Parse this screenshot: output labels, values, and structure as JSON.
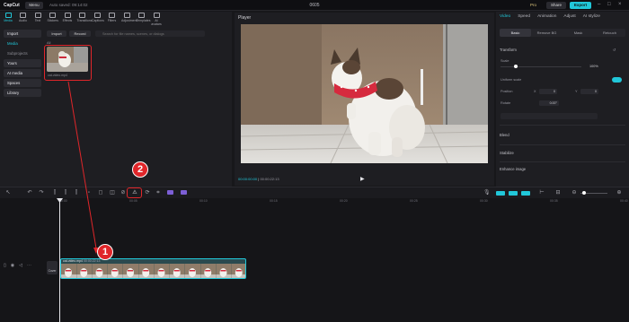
{
  "titlebar": {
    "app_name": "CapCut",
    "menu_label": "Menu",
    "autosave": "Auto saved: 09:14:02",
    "project_title": "0605",
    "pro_label": "Pro",
    "share_label": "Share",
    "export_label": "Export"
  },
  "tools": [
    {
      "label": "Media",
      "icon": "media-icon"
    },
    {
      "label": "Audio",
      "icon": "audio-icon"
    },
    {
      "label": "Text",
      "icon": "text-icon"
    },
    {
      "label": "Stickers",
      "icon": "stickers-icon"
    },
    {
      "label": "Effects",
      "icon": "effects-icon"
    },
    {
      "label": "Transitions",
      "icon": "transitions-icon"
    },
    {
      "label": "Captions",
      "icon": "captions-icon"
    },
    {
      "label": "Filters",
      "icon": "filters-icon"
    },
    {
      "label": "Adjustment",
      "icon": "adjustment-icon"
    },
    {
      "label": "Templates",
      "icon": "templates-icon"
    },
    {
      "label": "AI avatars",
      "icon": "ai-avatars-icon"
    }
  ],
  "sidenav": {
    "import": "Import",
    "media": "Media",
    "subprojects": "Subprojects",
    "yours": "Yours",
    "ai_media": "AI media",
    "spaces": "Spaces",
    "library": "Library"
  },
  "media": {
    "import_btn": "Import",
    "record_btn": "Record",
    "search_placeholder": "Search for file names, scenes, or dialogs",
    "all_label": "All",
    "clip_name": "cat-video.mp4"
  },
  "player": {
    "title": "Player",
    "time_current": "00:00:00:00",
    "time_total": "00:00:22:13"
  },
  "right_panel": {
    "tabs": [
      "Video",
      "Speed",
      "Animation",
      "Adjust",
      "AI stylize"
    ],
    "subtabs": [
      "Basic",
      "Remove BG",
      "Mask",
      "Retouch"
    ],
    "transform": "Transform",
    "scale": "Scale",
    "scale_value": "100%",
    "uniform_scale": "Uniform scale",
    "position": "Position",
    "pos_x": "0",
    "pos_y": "0",
    "rotate": "Rotate",
    "rotate_value": "0.00°",
    "blend": "Blend",
    "stabilize": "Stabilize",
    "enhance_image": "Enhance image"
  },
  "timeline": {
    "mirror_tooltip": "Mirror",
    "ruler": [
      "00:00",
      "00:05",
      "00:10",
      "00:15",
      "00:20",
      "00:25",
      "00:30",
      "00:35",
      "00:40"
    ],
    "clip_label": "cat-video.mp4",
    "clip_duration": "00:00:22:13",
    "cover_label": "Cover"
  },
  "annotations": {
    "badge_1": "1",
    "badge_2": "2",
    "accent_color": "#e0262a"
  }
}
